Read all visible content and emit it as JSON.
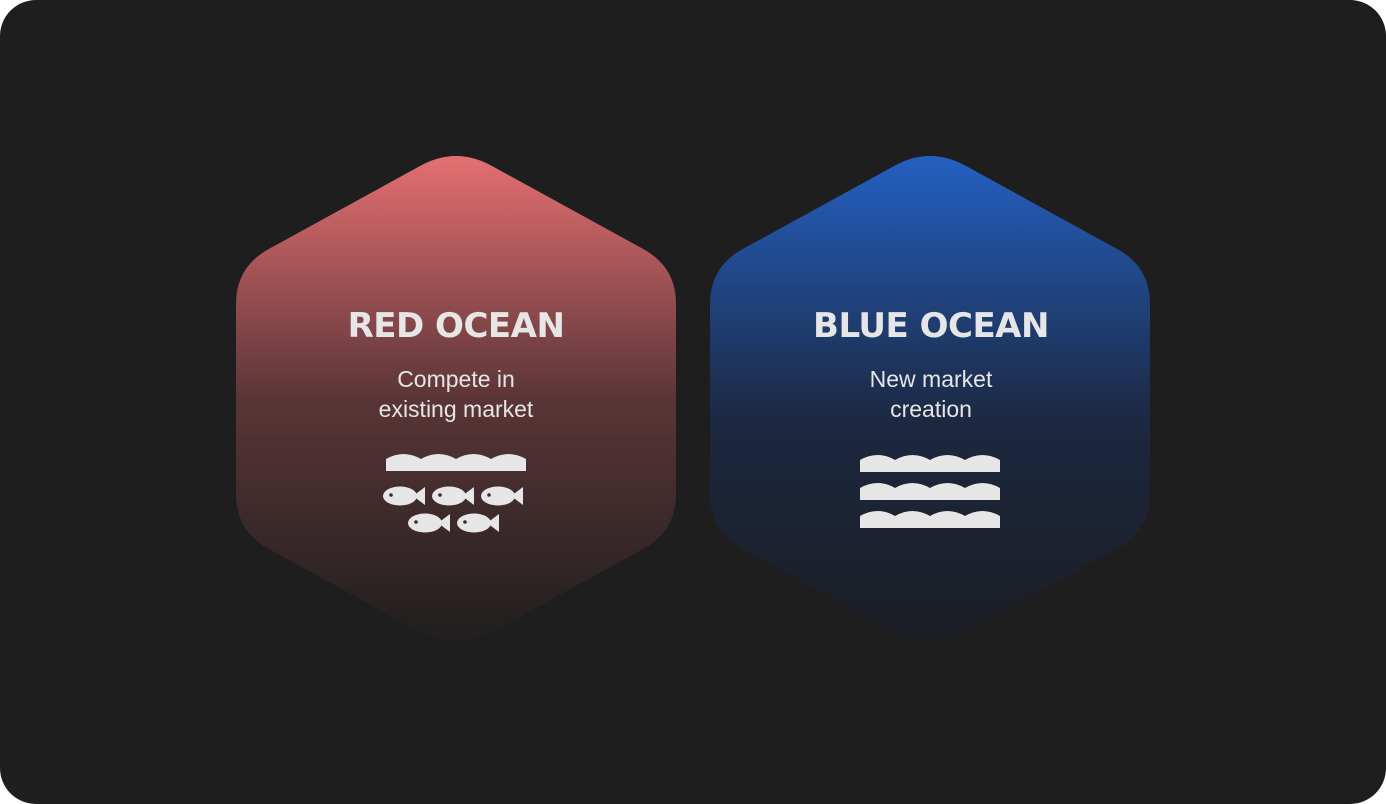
{
  "colors": {
    "background": "#1e1e1e",
    "red_top": "#e56f72",
    "red_bottom": "#1e1e1e",
    "blue_top": "#2460c2",
    "blue_bottom": "#1a1d24",
    "text": "#e6e6e6"
  },
  "cards": [
    {
      "title": "RED OCEAN",
      "subtitle_lines": [
        "Compete in",
        "existing market"
      ],
      "icon": "waves-with-fish-icon"
    },
    {
      "title": "BLUE OCEAN",
      "subtitle_lines": [
        "New market",
        "creation"
      ],
      "icon": "waves-icon"
    }
  ]
}
